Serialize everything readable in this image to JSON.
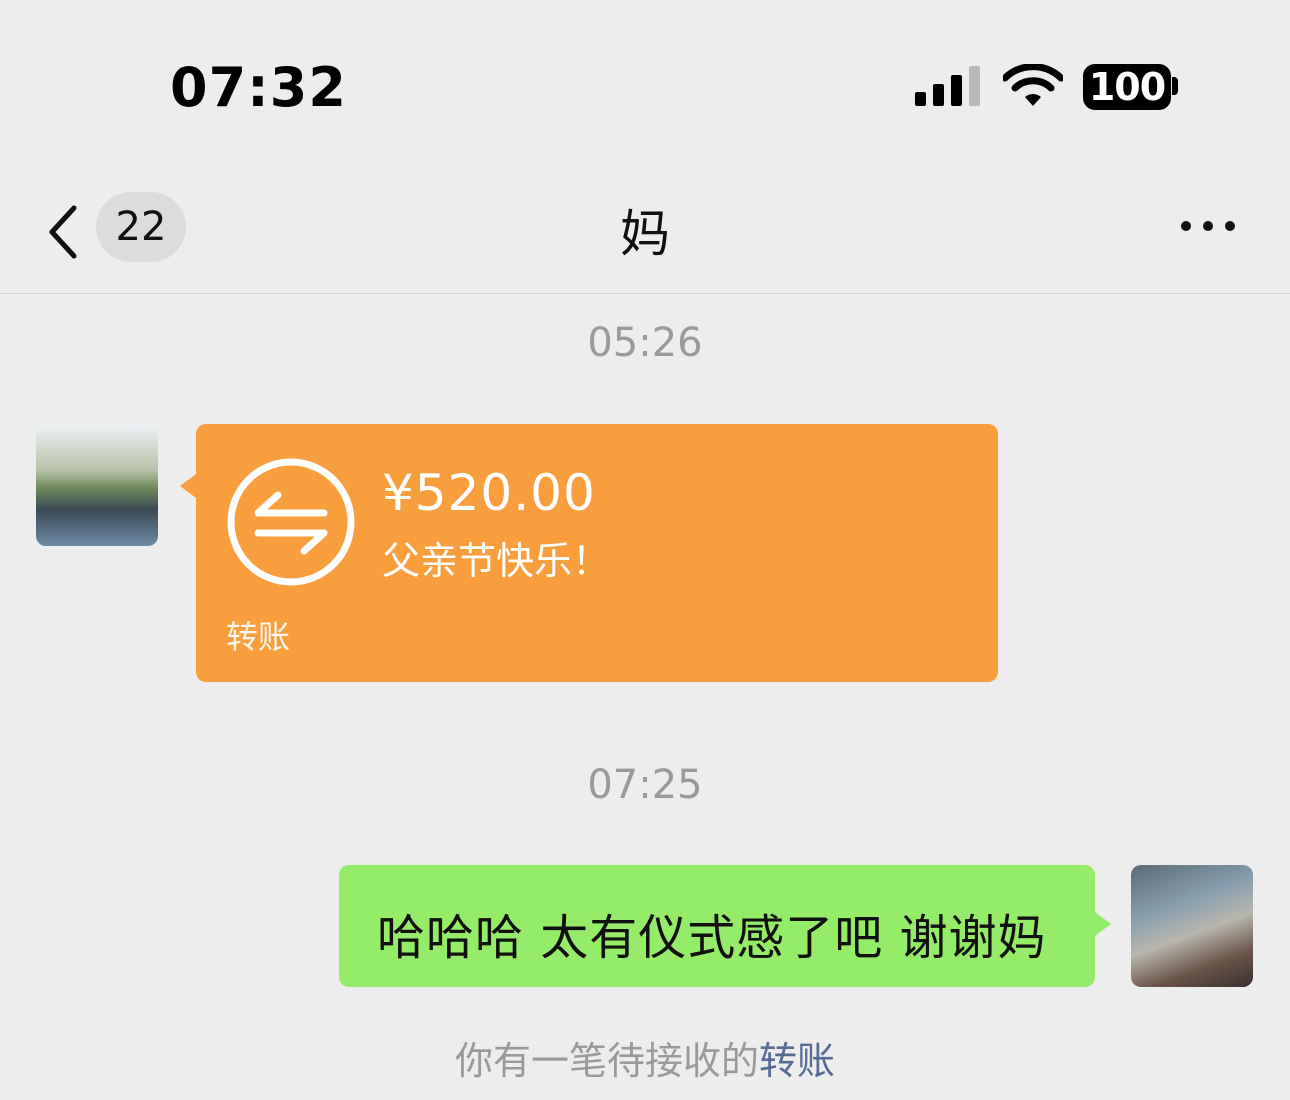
{
  "status_bar": {
    "time": "07:32",
    "battery": "100"
  },
  "nav": {
    "back_count": "22",
    "title": "妈"
  },
  "messages": [
    {
      "timestamp": "05:26"
    },
    {
      "type": "transfer",
      "amount": "¥520.00",
      "note": "父亲节快乐！",
      "label": "转账"
    },
    {
      "timestamp": "07:25"
    },
    {
      "type": "text",
      "text": "哈哈哈 太有仪式感了吧 谢谢妈"
    }
  ],
  "system_note": {
    "prefix": "你有一笔待接收的",
    "link": "转账"
  },
  "colors": {
    "transfer": "#f89e3c",
    "my_bubble": "#95ec69",
    "background": "#ededed",
    "link": "#576b95"
  },
  "icons": [
    "signal-icon",
    "wifi-icon",
    "back-chevron-icon",
    "more-icon",
    "transfer-icon"
  ]
}
